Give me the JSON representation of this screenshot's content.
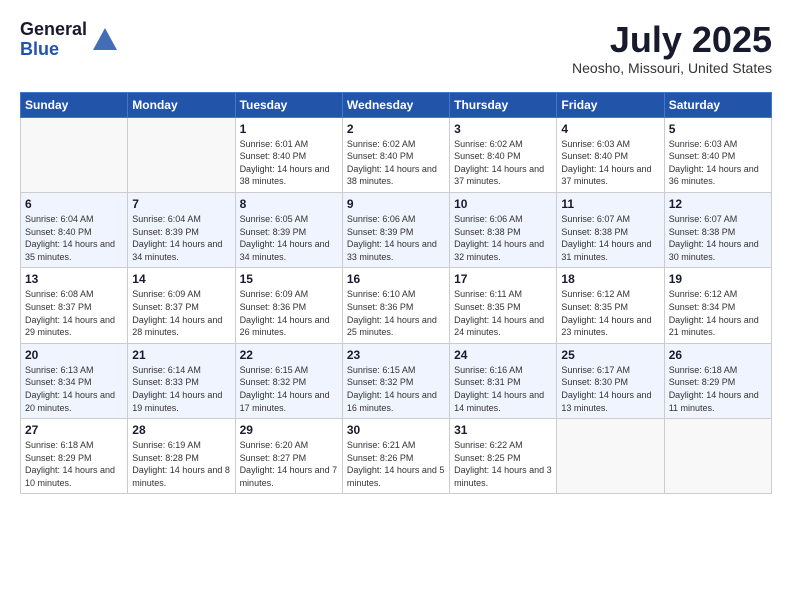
{
  "header": {
    "logo_general": "General",
    "logo_blue": "Blue",
    "title": "July 2025",
    "location": "Neosho, Missouri, United States"
  },
  "weekdays": [
    "Sunday",
    "Monday",
    "Tuesday",
    "Wednesday",
    "Thursday",
    "Friday",
    "Saturday"
  ],
  "weeks": [
    [
      {
        "day": null
      },
      {
        "day": null
      },
      {
        "day": "1",
        "sunrise": "Sunrise: 6:01 AM",
        "sunset": "Sunset: 8:40 PM",
        "daylight": "Daylight: 14 hours and 38 minutes."
      },
      {
        "day": "2",
        "sunrise": "Sunrise: 6:02 AM",
        "sunset": "Sunset: 8:40 PM",
        "daylight": "Daylight: 14 hours and 38 minutes."
      },
      {
        "day": "3",
        "sunrise": "Sunrise: 6:02 AM",
        "sunset": "Sunset: 8:40 PM",
        "daylight": "Daylight: 14 hours and 37 minutes."
      },
      {
        "day": "4",
        "sunrise": "Sunrise: 6:03 AM",
        "sunset": "Sunset: 8:40 PM",
        "daylight": "Daylight: 14 hours and 37 minutes."
      },
      {
        "day": "5",
        "sunrise": "Sunrise: 6:03 AM",
        "sunset": "Sunset: 8:40 PM",
        "daylight": "Daylight: 14 hours and 36 minutes."
      }
    ],
    [
      {
        "day": "6",
        "sunrise": "Sunrise: 6:04 AM",
        "sunset": "Sunset: 8:40 PM",
        "daylight": "Daylight: 14 hours and 35 minutes."
      },
      {
        "day": "7",
        "sunrise": "Sunrise: 6:04 AM",
        "sunset": "Sunset: 8:39 PM",
        "daylight": "Daylight: 14 hours and 34 minutes."
      },
      {
        "day": "8",
        "sunrise": "Sunrise: 6:05 AM",
        "sunset": "Sunset: 8:39 PM",
        "daylight": "Daylight: 14 hours and 34 minutes."
      },
      {
        "day": "9",
        "sunrise": "Sunrise: 6:06 AM",
        "sunset": "Sunset: 8:39 PM",
        "daylight": "Daylight: 14 hours and 33 minutes."
      },
      {
        "day": "10",
        "sunrise": "Sunrise: 6:06 AM",
        "sunset": "Sunset: 8:38 PM",
        "daylight": "Daylight: 14 hours and 32 minutes."
      },
      {
        "day": "11",
        "sunrise": "Sunrise: 6:07 AM",
        "sunset": "Sunset: 8:38 PM",
        "daylight": "Daylight: 14 hours and 31 minutes."
      },
      {
        "day": "12",
        "sunrise": "Sunrise: 6:07 AM",
        "sunset": "Sunset: 8:38 PM",
        "daylight": "Daylight: 14 hours and 30 minutes."
      }
    ],
    [
      {
        "day": "13",
        "sunrise": "Sunrise: 6:08 AM",
        "sunset": "Sunset: 8:37 PM",
        "daylight": "Daylight: 14 hours and 29 minutes."
      },
      {
        "day": "14",
        "sunrise": "Sunrise: 6:09 AM",
        "sunset": "Sunset: 8:37 PM",
        "daylight": "Daylight: 14 hours and 28 minutes."
      },
      {
        "day": "15",
        "sunrise": "Sunrise: 6:09 AM",
        "sunset": "Sunset: 8:36 PM",
        "daylight": "Daylight: 14 hours and 26 minutes."
      },
      {
        "day": "16",
        "sunrise": "Sunrise: 6:10 AM",
        "sunset": "Sunset: 8:36 PM",
        "daylight": "Daylight: 14 hours and 25 minutes."
      },
      {
        "day": "17",
        "sunrise": "Sunrise: 6:11 AM",
        "sunset": "Sunset: 8:35 PM",
        "daylight": "Daylight: 14 hours and 24 minutes."
      },
      {
        "day": "18",
        "sunrise": "Sunrise: 6:12 AM",
        "sunset": "Sunset: 8:35 PM",
        "daylight": "Daylight: 14 hours and 23 minutes."
      },
      {
        "day": "19",
        "sunrise": "Sunrise: 6:12 AM",
        "sunset": "Sunset: 8:34 PM",
        "daylight": "Daylight: 14 hours and 21 minutes."
      }
    ],
    [
      {
        "day": "20",
        "sunrise": "Sunrise: 6:13 AM",
        "sunset": "Sunset: 8:34 PM",
        "daylight": "Daylight: 14 hours and 20 minutes."
      },
      {
        "day": "21",
        "sunrise": "Sunrise: 6:14 AM",
        "sunset": "Sunset: 8:33 PM",
        "daylight": "Daylight: 14 hours and 19 minutes."
      },
      {
        "day": "22",
        "sunrise": "Sunrise: 6:15 AM",
        "sunset": "Sunset: 8:32 PM",
        "daylight": "Daylight: 14 hours and 17 minutes."
      },
      {
        "day": "23",
        "sunrise": "Sunrise: 6:15 AM",
        "sunset": "Sunset: 8:32 PM",
        "daylight": "Daylight: 14 hours and 16 minutes."
      },
      {
        "day": "24",
        "sunrise": "Sunrise: 6:16 AM",
        "sunset": "Sunset: 8:31 PM",
        "daylight": "Daylight: 14 hours and 14 minutes."
      },
      {
        "day": "25",
        "sunrise": "Sunrise: 6:17 AM",
        "sunset": "Sunset: 8:30 PM",
        "daylight": "Daylight: 14 hours and 13 minutes."
      },
      {
        "day": "26",
        "sunrise": "Sunrise: 6:18 AM",
        "sunset": "Sunset: 8:29 PM",
        "daylight": "Daylight: 14 hours and 11 minutes."
      }
    ],
    [
      {
        "day": "27",
        "sunrise": "Sunrise: 6:18 AM",
        "sunset": "Sunset: 8:29 PM",
        "daylight": "Daylight: 14 hours and 10 minutes."
      },
      {
        "day": "28",
        "sunrise": "Sunrise: 6:19 AM",
        "sunset": "Sunset: 8:28 PM",
        "daylight": "Daylight: 14 hours and 8 minutes."
      },
      {
        "day": "29",
        "sunrise": "Sunrise: 6:20 AM",
        "sunset": "Sunset: 8:27 PM",
        "daylight": "Daylight: 14 hours and 7 minutes."
      },
      {
        "day": "30",
        "sunrise": "Sunrise: 6:21 AM",
        "sunset": "Sunset: 8:26 PM",
        "daylight": "Daylight: 14 hours and 5 minutes."
      },
      {
        "day": "31",
        "sunrise": "Sunrise: 6:22 AM",
        "sunset": "Sunset: 8:25 PM",
        "daylight": "Daylight: 14 hours and 3 minutes."
      },
      {
        "day": null
      },
      {
        "day": null
      }
    ]
  ]
}
